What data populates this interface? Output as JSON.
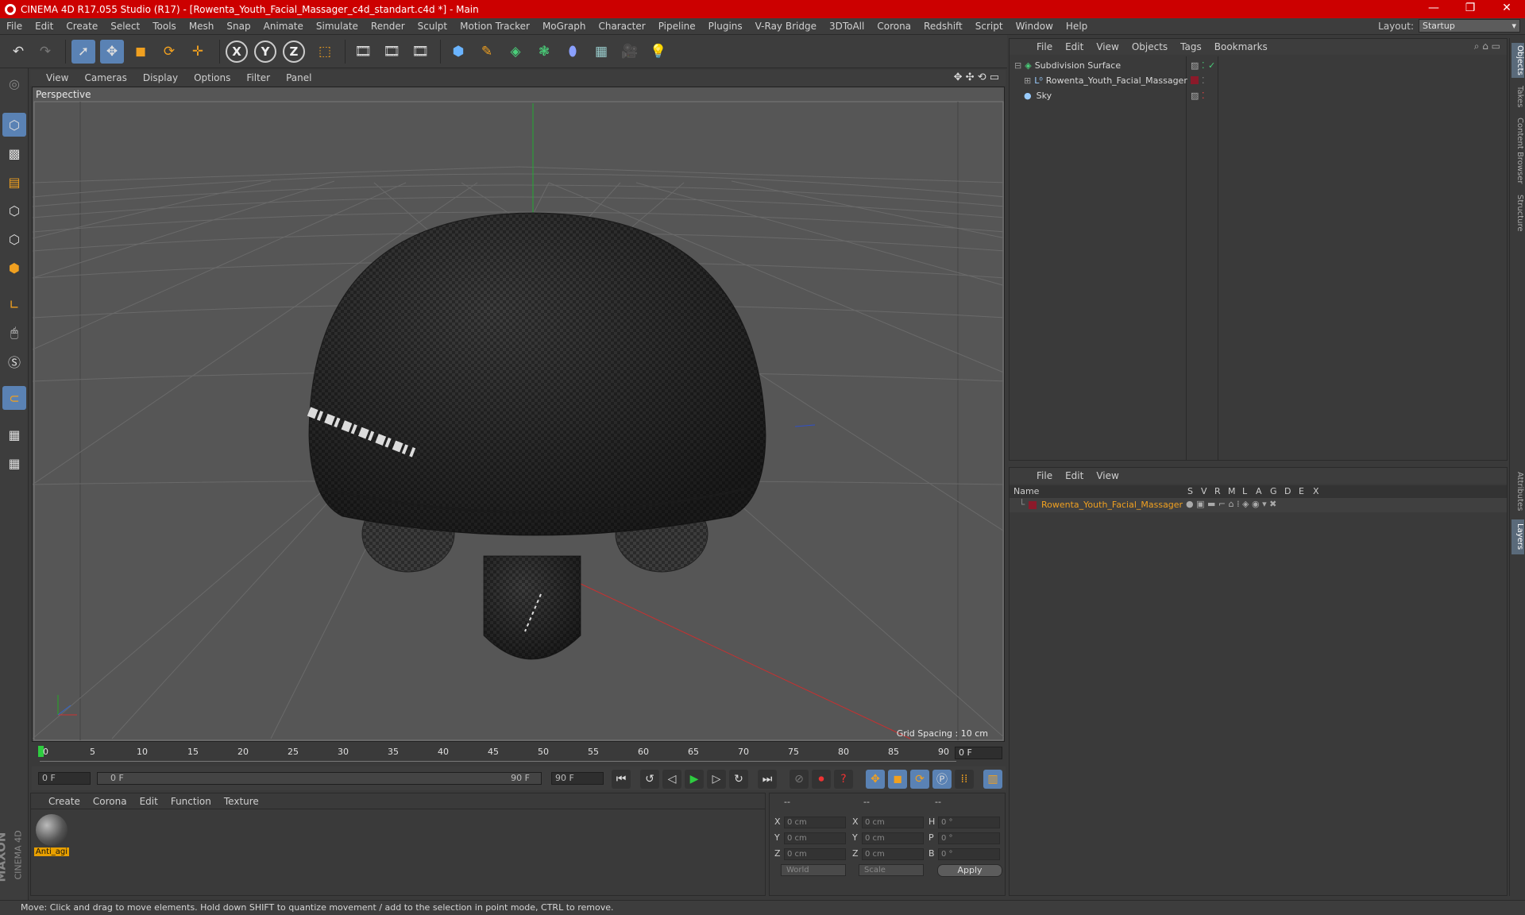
{
  "window": {
    "title": "CINEMA 4D R17.055 Studio (R17) - [Rowenta_Youth_Facial_Massager_c4d_standart.c4d *] - Main",
    "minimize": "—",
    "maximize": "❐",
    "close": "✕"
  },
  "menubar": {
    "items": [
      "File",
      "Edit",
      "Create",
      "Select",
      "Tools",
      "Mesh",
      "Snap",
      "Animate",
      "Simulate",
      "Render",
      "Sculpt",
      "Motion Tracker",
      "MoGraph",
      "Character",
      "Pipeline",
      "Plugins",
      "V-Ray Bridge",
      "3DToAll",
      "Corona",
      "Redshift",
      "Script",
      "Window",
      "Help"
    ],
    "layout_label": "Layout:",
    "layout_value": "Startup"
  },
  "toolbar": {
    "axis_x": "X",
    "axis_y": "Y",
    "axis_z": "Z"
  },
  "viewport": {
    "menu": [
      "View",
      "Cameras",
      "Display",
      "Options",
      "Filter",
      "Panel"
    ],
    "label": "Perspective",
    "grid_spacing": "Grid Spacing : 10 cm"
  },
  "timeline": {
    "ticks": [
      "0",
      "5",
      "10",
      "15",
      "20",
      "25",
      "30",
      "35",
      "40",
      "45",
      "50",
      "55",
      "60",
      "65",
      "70",
      "75",
      "80",
      "85",
      "90"
    ],
    "frame_end": "0 F"
  },
  "transport": {
    "current_frame": "0 F",
    "range_start": "0 F",
    "range_end_inner": "90 F",
    "range_end": "90 F"
  },
  "material_panel": {
    "menu": [
      "Create",
      "Corona",
      "Edit",
      "Function",
      "Texture"
    ],
    "material_name": "Anti_agi"
  },
  "coordinates": {
    "header_a": "--",
    "header_b": "--",
    "header_c": "--",
    "rows": [
      {
        "a": "X",
        "a_val": "0 cm",
        "b": "X",
        "b_val": "0 cm",
        "c": "H",
        "c_val": "0 °"
      },
      {
        "a": "Y",
        "a_val": "0 cm",
        "b": "Y",
        "b_val": "0 cm",
        "c": "P",
        "c_val": "0 °"
      },
      {
        "a": "Z",
        "a_val": "0 cm",
        "b": "Z",
        "b_val": "0 cm",
        "c": "B",
        "c_val": "0 °"
      }
    ],
    "world": "World",
    "scale": "Scale",
    "apply": "Apply"
  },
  "object_manager": {
    "menu": [
      "File",
      "Edit",
      "View",
      "Objects",
      "Tags",
      "Bookmarks"
    ],
    "objects": [
      {
        "name": "Subdivision Surface"
      },
      {
        "name": "Rowenta_Youth_Facial_Massager"
      },
      {
        "name": "Sky"
      }
    ]
  },
  "layer_manager": {
    "menu": [
      "File",
      "Edit",
      "View"
    ],
    "columns": [
      "Name",
      "S",
      "V",
      "R",
      "M",
      "L",
      "A",
      "G",
      "D",
      "E",
      "X"
    ],
    "layer_name": "Rowenta_Youth_Facial_Massager"
  },
  "right_tabs": [
    "Objects",
    "Takes",
    "Content Browser",
    "Structure",
    "Attributes",
    "Layers"
  ],
  "logo": {
    "maxon": "MAXON",
    "c4d": "CINEMA 4D"
  },
  "status": "Move: Click and drag to move elements. Hold down SHIFT to quantize movement / add to the selection in point mode, CTRL to remove.",
  "colors": {
    "title_bar": "#cc0000",
    "active_tool": "#5a82b4",
    "material_label": "#e8a000",
    "layer_color": "#8b1a2a"
  }
}
